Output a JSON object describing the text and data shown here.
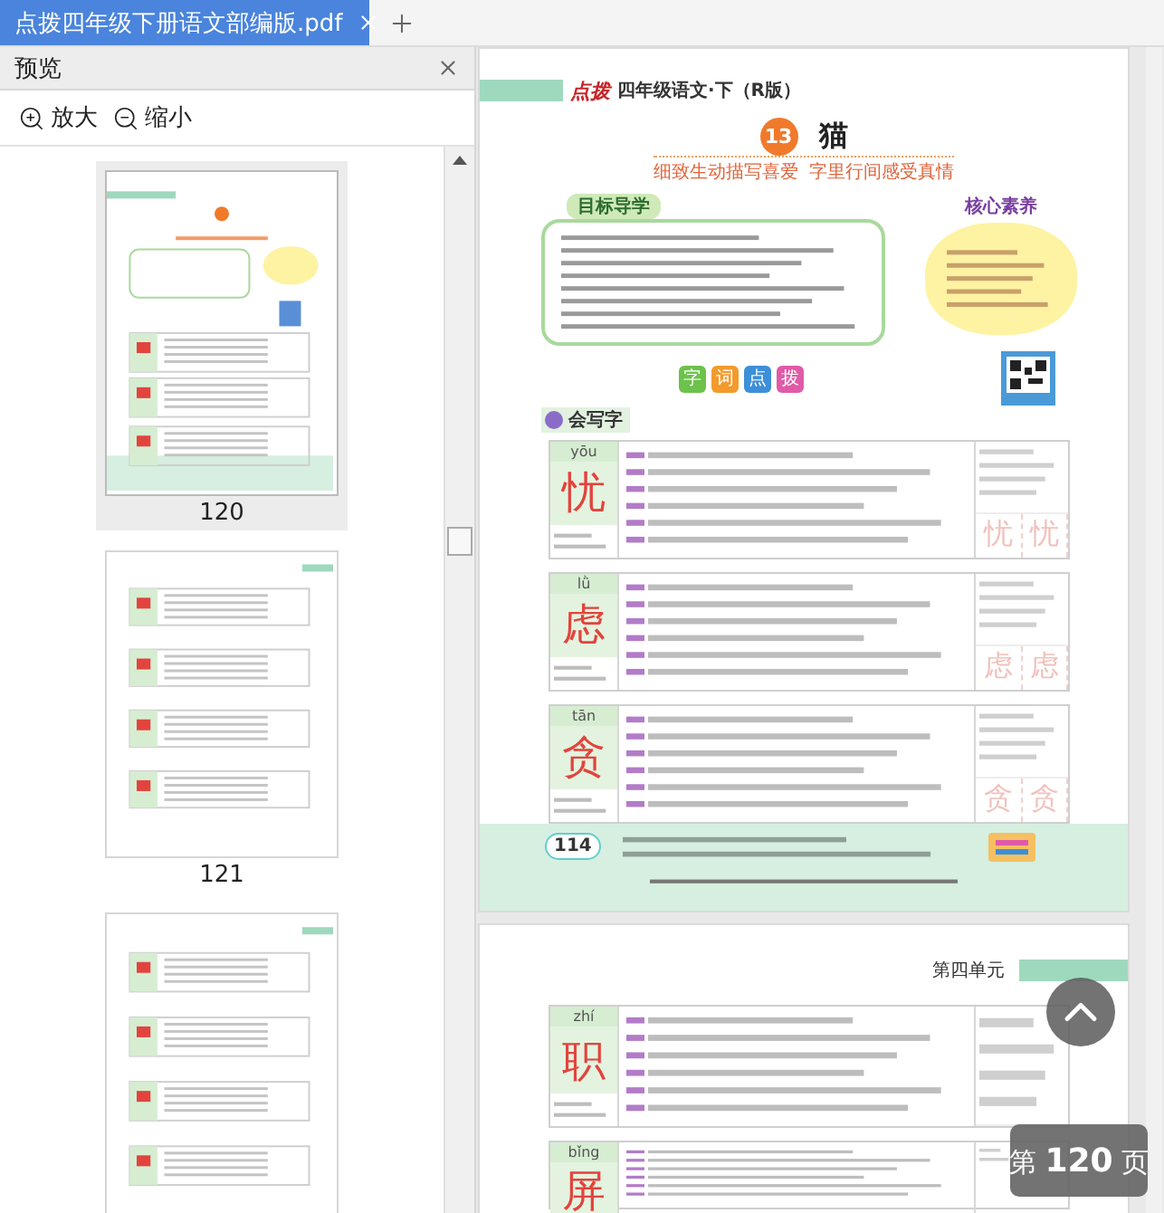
{
  "tabs": [
    {
      "label": "点拨四年级下册语文部编版.pdf",
      "selected": true
    }
  ],
  "preview_panel": {
    "title": "预览",
    "zoom_in": "放大",
    "zoom_out": "缩小",
    "thumbnails": [
      {
        "label": "120",
        "selected": true
      },
      {
        "label": "121",
        "selected": false
      },
      {
        "selected": false
      }
    ]
  },
  "document": {
    "pages": [
      {
        "kind": "lesson",
        "header": {
          "logo": "点拨",
          "title": "四年级语文·下（R版）"
        },
        "lesson": {
          "number": "13",
          "title": "猫",
          "subtitle": "细致生动描写喜爱  字里行间感受真情"
        },
        "goals_heading": "目标导学",
        "core_heading": "核心素养",
        "banner_tiles": [
          {
            "label": "字",
            "color": "#6cc24a"
          },
          {
            "label": "词",
            "color": "#f39a2b"
          },
          {
            "label": "点",
            "color": "#3d8fd8"
          },
          {
            "label": "拨",
            "color": "#e05aa8"
          }
        ],
        "section": "会写字",
        "characters": [
          {
            "pinyin": "yōu",
            "char": "忧",
            "tracing": [
              "忧",
              "忧"
            ]
          },
          {
            "pinyin": "lǜ",
            "char": "虑",
            "tracing": [
              "虑",
              "虑"
            ]
          },
          {
            "pinyin": "tān",
            "char": "贪",
            "tracing": [
              "贪",
              "贪"
            ]
          }
        ],
        "footer": {
          "page_number": "114"
        }
      },
      {
        "kind": "continuation",
        "unit": "第四单元",
        "characters": [
          {
            "pinyin": "zhí",
            "char": "职"
          },
          {
            "pinyin": "bǐng",
            "char": "屏"
          }
        ]
      }
    ]
  },
  "page_indicator": "第 **120** 页"
}
